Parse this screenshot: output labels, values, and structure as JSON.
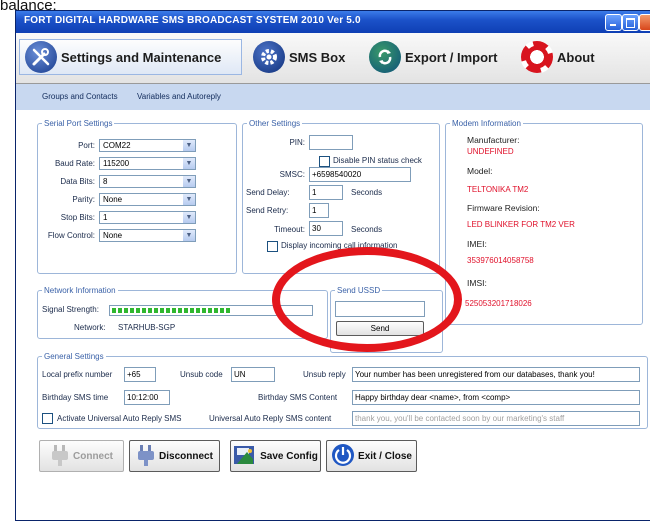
{
  "caption": "balance:",
  "window": {
    "title": "FORT DIGITAL HARDWARE SMS BROADCAST SYSTEM 2010 Ver 5.0"
  },
  "tabs": [
    {
      "label": "Settings and Maintenance",
      "icon": "wrench-screwdriver-icon"
    },
    {
      "label": "SMS Box",
      "icon": "gear-icon"
    },
    {
      "label": "Export / Import",
      "icon": "sync-arrows-icon"
    },
    {
      "label": "About",
      "icon": "lifebuoy-icon"
    }
  ],
  "subtabs": [
    "Groups and Contacts",
    "Variables and Autoreply"
  ],
  "serial_port": {
    "title": "Serial Port Settings",
    "port_label": "Port:",
    "port_value": "COM22",
    "baud_label": "Baud Rate:",
    "baud_value": "115200",
    "databits_label": "Data Bits:",
    "databits_value": "8",
    "parity_label": "Parity:",
    "parity_value": "None",
    "stopbits_label": "Stop Bits:",
    "stopbits_value": "1",
    "flow_label": "Flow Control:",
    "flow_value": "None"
  },
  "other_settings": {
    "title": "Other Settings",
    "pin_label": "PIN:",
    "pin_value": "",
    "disable_pin_label": "Disable PIN status check",
    "smsc_label": "SMSC:",
    "smsc_value": "+6598540020",
    "delay_label": "Send Delay:",
    "delay_value": "1",
    "delay_unit": "Seconds",
    "retry_label": "Send Retry:",
    "retry_value": "1",
    "timeout_label": "Timeout:",
    "timeout_value": "30",
    "timeout_unit": "Seconds",
    "display_incoming_label": "Display incoming call information"
  },
  "modem": {
    "title": "Modem Information",
    "manufacturer_label": "Manufacturer:",
    "manufacturer_value": "UNDEFINED",
    "model_label": "Model:",
    "model_value": "TELTONIKA TM2",
    "firmware_label": "Firmware Revision:",
    "firmware_value": "LED BLINKER FOR TM2 VER",
    "imei_label": "IMEI:",
    "imei_value": "353976014058758",
    "imsi_label": "IMSI:",
    "imsi_value": "525053201718026"
  },
  "network": {
    "title": "Network Information",
    "signal_label": "Signal Strength:",
    "signal_level": 0.6,
    "network_label": "Network:",
    "network_value": "STARHUB-SGP"
  },
  "ussd": {
    "title": "Send USSD",
    "input_value": "",
    "send_label": "Send"
  },
  "general": {
    "title": "General Settings",
    "prefix_label": "Local prefix number",
    "prefix_value": "+65",
    "unsub_code_label": "Unsub code",
    "unsub_code_value": "UN",
    "unsub_reply_label": "Unsub reply",
    "unsub_reply_value": "Your number has been unregistered from our databases, thank you!",
    "bday_time_label": "Birthday SMS time",
    "bday_time_value": "10:12:00",
    "bday_content_label": "Birthday SMS Content",
    "bday_content_value": "Happy birthday dear <name>, from <comp>",
    "auto_reply_check_label": "Activate Universal Auto Reply SMS",
    "auto_reply_content_label": "Universal Auto Reply SMS content",
    "auto_reply_content_value": "thank you, you'll be contacted soon by our marketing's staff"
  },
  "buttons": {
    "connect": "Connect",
    "disconnect": "Disconnect",
    "save": "Save Config",
    "exit": "Exit / Close"
  }
}
